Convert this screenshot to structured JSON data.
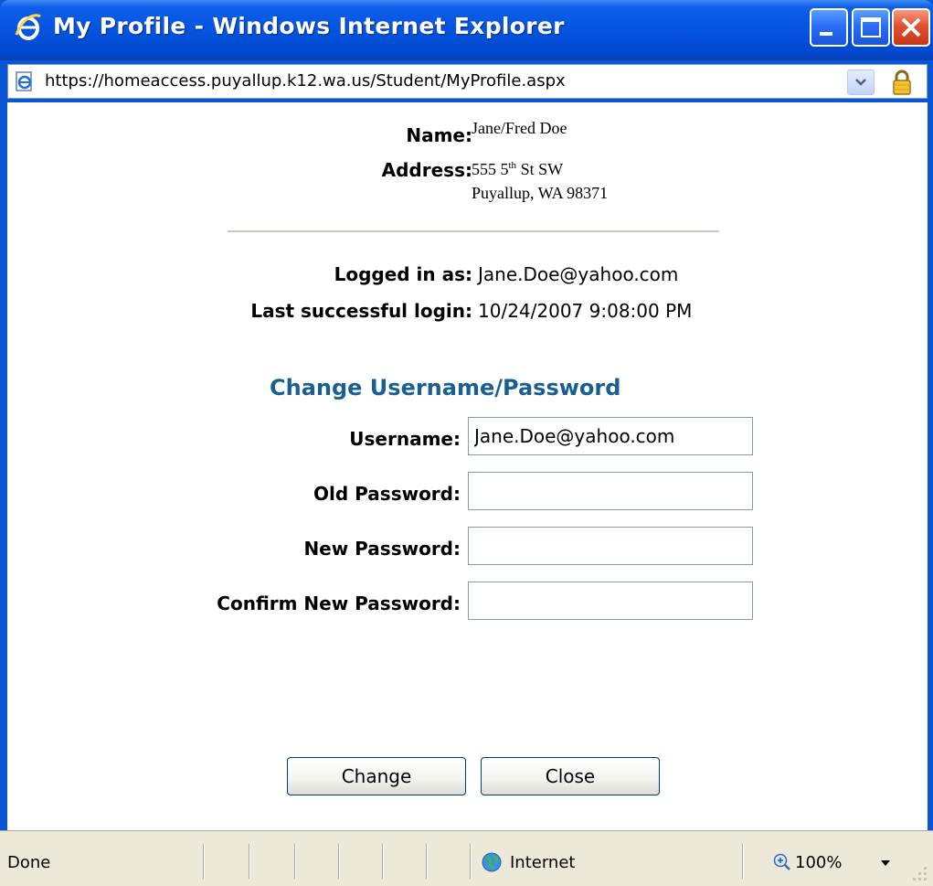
{
  "window": {
    "title": "My Profile - Windows Internet Explorer",
    "address_url": "https://homeaccess.puyallup.k12.wa.us/Student/MyProfile.aspx"
  },
  "profile": {
    "name_label": "Name:",
    "name_value": "Jane/Fred Doe",
    "address_label": "Address:",
    "address_line1_number": "555 5",
    "address_line1_sup": "th",
    "address_line1_rest": " St SW",
    "address_line2": "Puyallup, WA 98371"
  },
  "login": {
    "logged_in_label": "Logged in as:",
    "logged_in_value": "Jane.Doe@yahoo.com",
    "last_login_label": "Last successful login:",
    "last_login_value": "10/24/2007 9:08:00 PM"
  },
  "change_form": {
    "title": "Change Username/Password",
    "username_label": "Username:",
    "username_value": "Jane.Doe@yahoo.com",
    "old_password_label": "Old Password:",
    "old_password_value": "",
    "new_password_label": "New Password:",
    "new_password_value": "",
    "confirm_password_label": "Confirm New Password:",
    "confirm_password_value": ""
  },
  "buttons": {
    "change_label": "Change",
    "close_label": "Close"
  },
  "statusbar": {
    "status_text": "Done",
    "zone_text": "Internet",
    "zoom_text": "100%"
  },
  "colors": {
    "section_title": "#1a5f93",
    "title_bar": "#0554e0",
    "close_button": "#e2522e"
  },
  "icons": [
    "ie-logo-icon",
    "minimize-icon",
    "maximize-icon",
    "close-icon",
    "page-icon",
    "dropdown-arrow-icon",
    "lock-icon",
    "globe-icon",
    "zoom-icon",
    "resize-grip-icon"
  ]
}
